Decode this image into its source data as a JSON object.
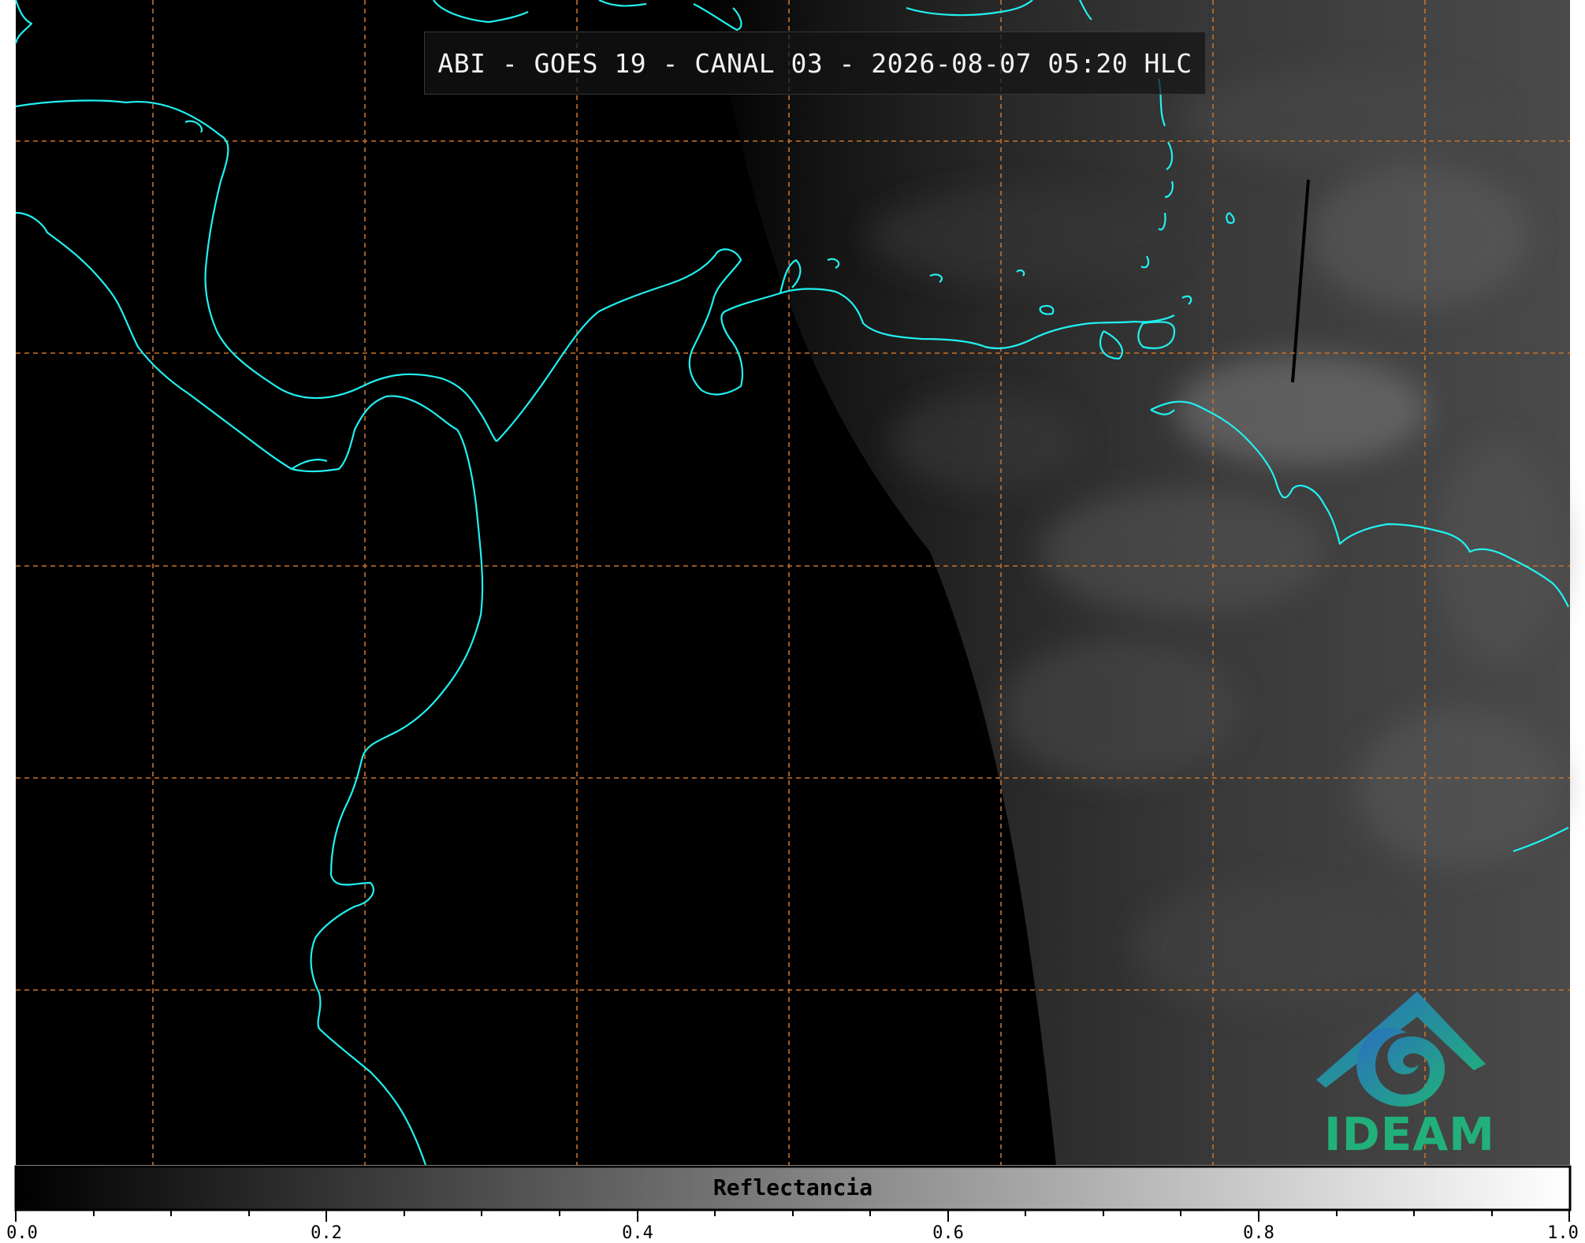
{
  "title": "ABI - GOES 19 - CANAL 03 - 2026-08-07 05:20 HLC",
  "colorbar": {
    "label": "Reflectancia",
    "ticks": [
      "0.0",
      "0.2",
      "0.4",
      "0.6",
      "0.8",
      "1.0"
    ],
    "range": [
      0.0,
      1.0
    ]
  },
  "logo": {
    "text": "IDEAM"
  },
  "colors": {
    "coastline": "#22f0f0",
    "gridlines": "#c8722a",
    "logo_primary": "#21b07a",
    "logo_secondary": "#2a6fc0"
  }
}
